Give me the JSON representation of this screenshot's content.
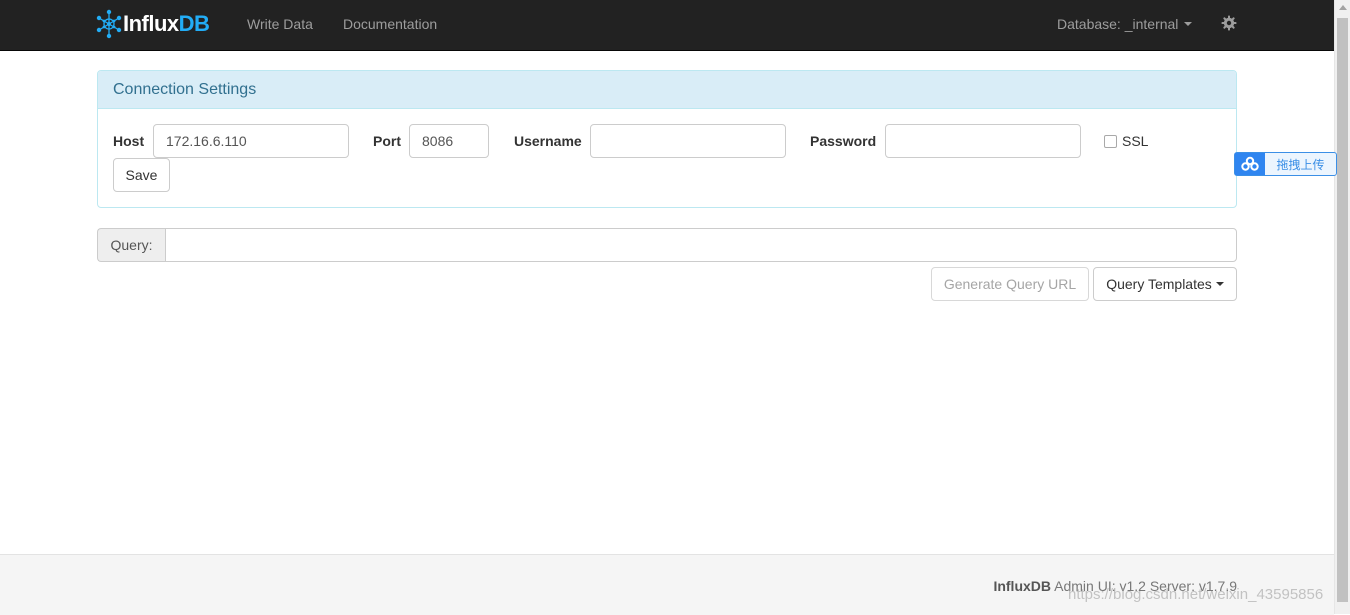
{
  "navbar": {
    "brand_influx": "Influx",
    "brand_db": "DB",
    "write_data": "Write Data",
    "documentation": "Documentation",
    "database_label": "Database: _internal"
  },
  "connection": {
    "title": "Connection Settings",
    "host_label": "Host",
    "host_value": "172.16.6.110",
    "port_label": "Port",
    "port_value": "8086",
    "username_label": "Username",
    "username_value": "",
    "password_label": "Password",
    "password_value": "",
    "ssl_label": "SSL",
    "ssl_checked": false,
    "save_label": "Save"
  },
  "query": {
    "label": "Query:",
    "value": "",
    "generate_url_label": "Generate Query URL",
    "templates_label": "Query Templates"
  },
  "upload_widget": {
    "label": "拖拽上传"
  },
  "footer": {
    "brand": "InfluxDB",
    "version_text": "Admin UI: v1.2 Server: v1.7.9"
  },
  "watermark": "https://blog.csdn.net/weixin_43595856",
  "colors": {
    "navbar_bg": "#222222",
    "brand_accent": "#22adf6",
    "panel_heading_bg": "#d9edf7",
    "panel_heading_text": "#31708f"
  }
}
